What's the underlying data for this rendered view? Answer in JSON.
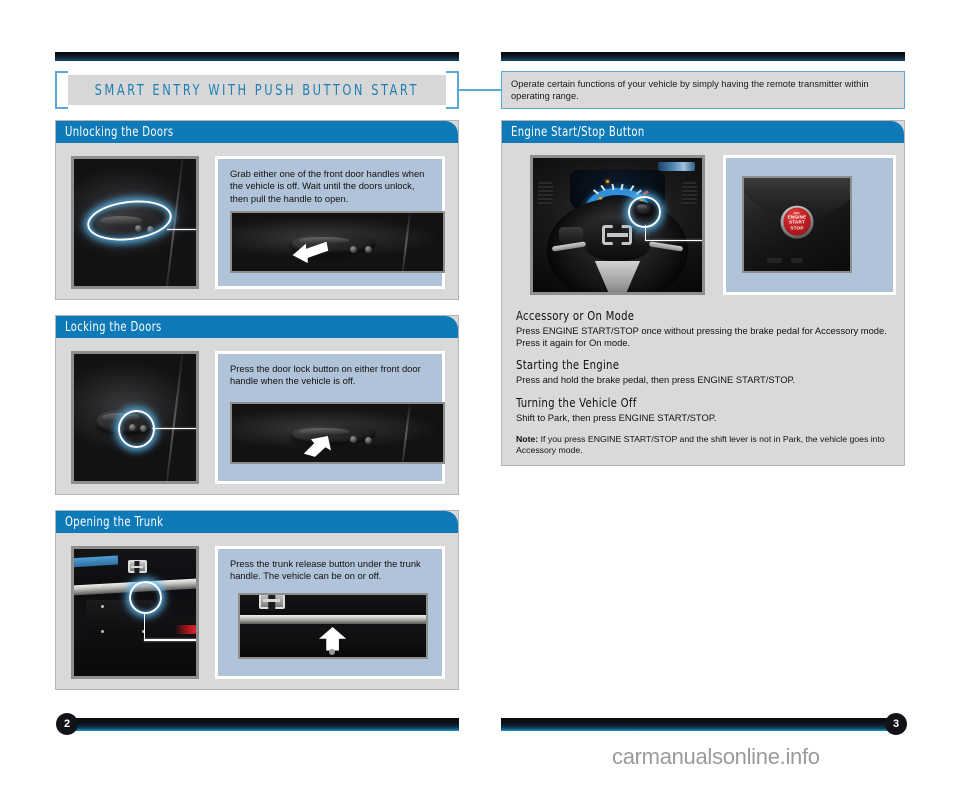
{
  "document": {
    "title": "SMART ENTRY WITH PUSH BUTTON START",
    "watermark": "carmanualsonline.info"
  },
  "callout": {
    "text": "Operate certain functions of your vehicle by simply having the remote transmitter within operating range."
  },
  "pages": {
    "left": "2",
    "right": "3"
  },
  "colors": {
    "panel_header_blue": "#0f7ab8",
    "title_blue": "#1f7fb5",
    "bracket_blue": "#5aa9d6",
    "panel_bg": "#d9d9d9",
    "info_card_bg": "#b0c3d8",
    "start_button_red": "#c01f22"
  },
  "panels": [
    {
      "id": "unlocking-the-doors",
      "header": "Unlocking the Doors",
      "description": "Grab either one of the front door handles when the vehicle is off. Wait until the doors unlock, then pull the handle to open.",
      "thumb_alt": "door-handle-photo",
      "detail_alt": "door-handle-pull-photo"
    },
    {
      "id": "locking-the-doors",
      "header": "Locking the Doors",
      "description": "Press the door lock button on either front door handle when the vehicle is off.",
      "thumb_alt": "door-lock-button-photo",
      "detail_alt": "door-lock-button-press-photo"
    },
    {
      "id": "opening-the-trunk",
      "header": "Opening the Trunk",
      "description": "Press the trunk release button under the trunk handle. The vehicle can be on or off.",
      "thumb_alt": "trunk-lid-photo",
      "detail_alt": "trunk-release-button-photo"
    }
  ],
  "engine_panel": {
    "header": "Engine Start/Stop Button",
    "thumb_alt": "steering-wheel-dashboard-photo",
    "detail_alt": "engine-start-stop-button-photo",
    "button_label": {
      "line1": "ENGINE",
      "line2": "START",
      "line3": "STOP"
    },
    "sections": [
      {
        "heading": "Accessory or On Mode",
        "body": "Press ENGINE START/STOP once without pressing the brake pedal for Accessory mode. Press it again for On mode."
      },
      {
        "heading": "Starting the Engine",
        "body": "Press and hold the brake pedal,  then press ENGINE START/STOP."
      },
      {
        "heading": "Turning the Vehicle Off",
        "body": "Shift to Park, then press ENGINE START/STOP."
      }
    ],
    "note_label": "Note:",
    "note_body": " If you press ENGINE START/STOP and the shift lever is not in Park, the vehicle goes into Accessory mode."
  }
}
